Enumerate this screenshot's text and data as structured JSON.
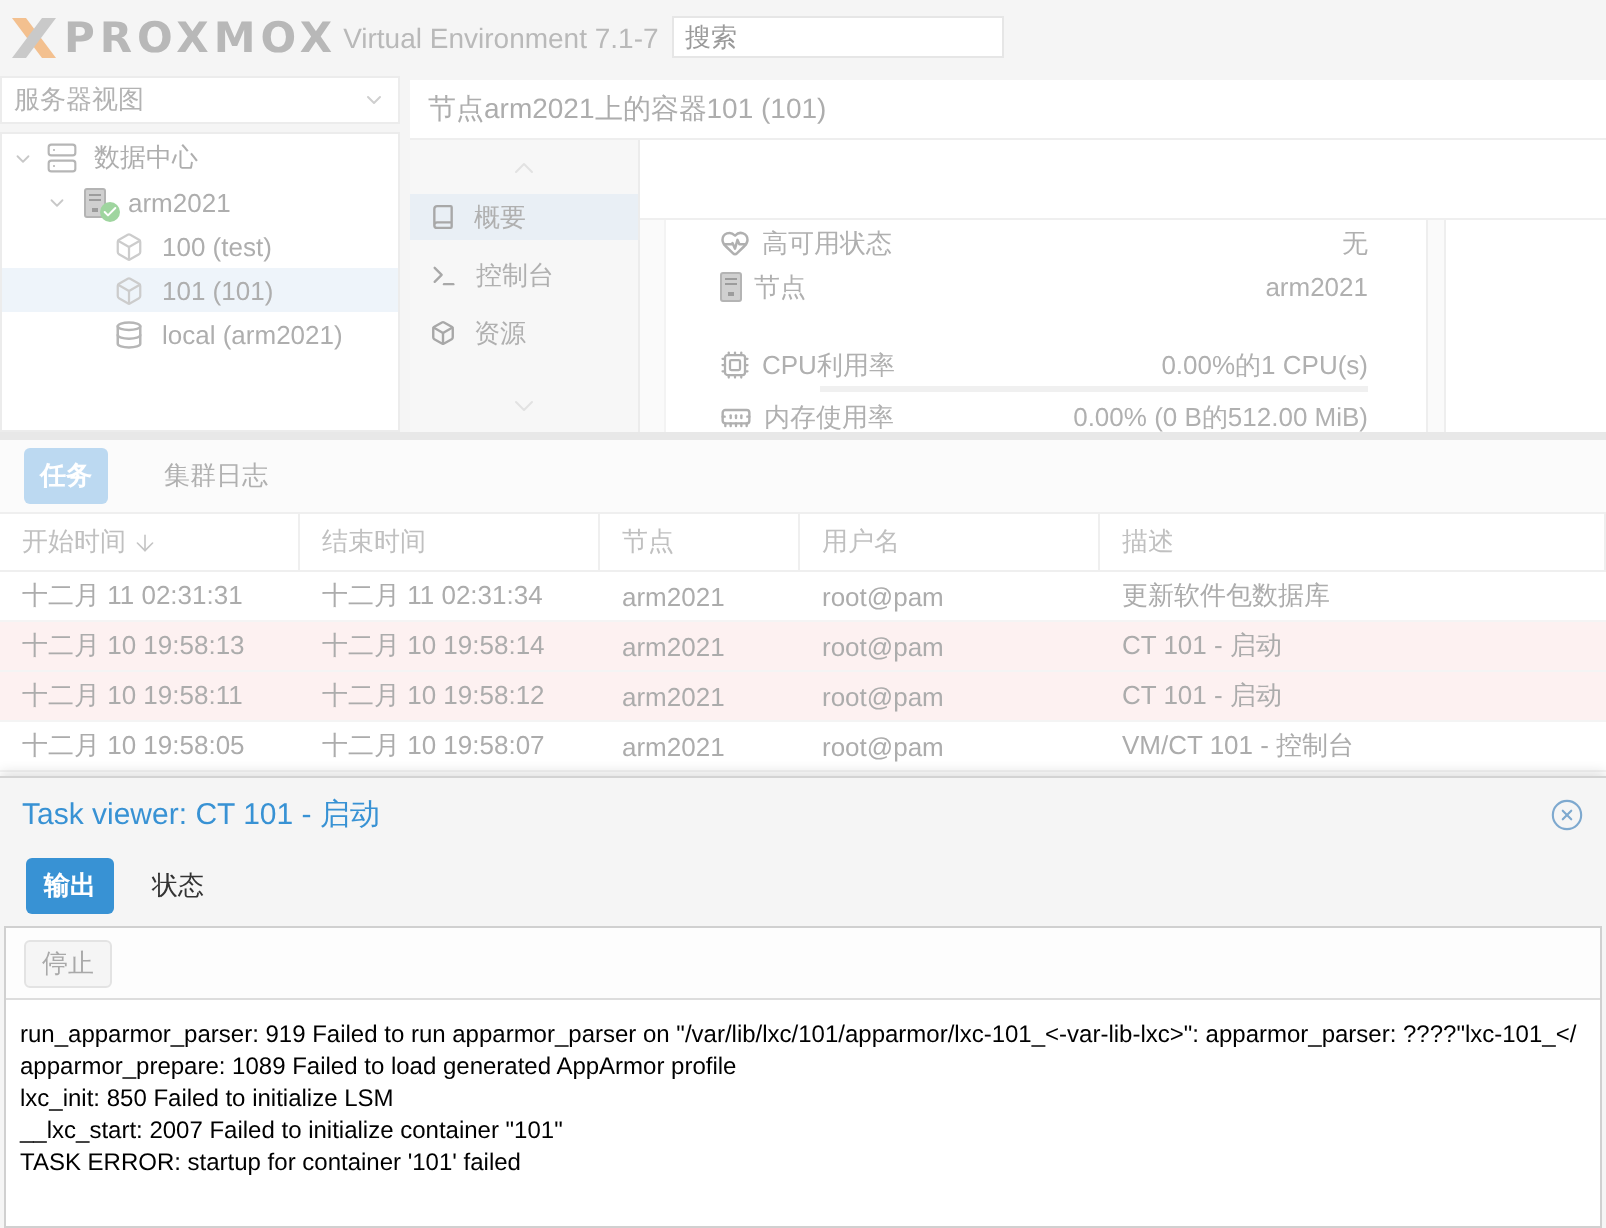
{
  "header": {
    "logo": "PROXMOX",
    "version": "Virtual Environment 7.1-7",
    "search": {
      "placeholder": "搜索"
    }
  },
  "sidebar": {
    "view_select": {
      "value": "服务器视图"
    },
    "tree": [
      {
        "kind": "datacenter",
        "label": "数据中心",
        "expanded": true,
        "selected": false,
        "children": [
          {
            "kind": "node",
            "label": "arm2021",
            "expanded": true,
            "selected": false,
            "online": true,
            "children": [
              {
                "kind": "container",
                "label": "100 (test)",
                "selected": false
              },
              {
                "kind": "container",
                "label": "101 (101)",
                "selected": true
              },
              {
                "kind": "storage",
                "label": "local (arm2021)",
                "selected": false
              }
            ]
          }
        ]
      }
    ]
  },
  "content": {
    "title": "节点arm2021上的容器101 (101)",
    "nav": [
      {
        "kind": "summary",
        "label": "概要",
        "selected": true
      },
      {
        "kind": "console",
        "label": "控制台",
        "selected": false
      },
      {
        "kind": "resources",
        "label": "资源",
        "selected": false
      }
    ],
    "summary_groups": [
      {
        "rows": [
          {
            "kind": "ha",
            "label": "高可用状态",
            "value": "无"
          },
          {
            "kind": "node",
            "label": "节点",
            "value": "arm2021"
          }
        ]
      },
      {
        "rows": [
          {
            "kind": "cpu",
            "label": "CPU利用率",
            "value": "0.00%的1 CPU(s)"
          },
          {
            "kind": "memory",
            "label": "内存使用率",
            "value": "0.00% (0 B的512.00 MiB)"
          }
        ]
      }
    ]
  },
  "log_panel": {
    "tabs": [
      {
        "label": "任务",
        "selected": true
      },
      {
        "label": "集群日志",
        "selected": false
      }
    ],
    "columns": [
      {
        "label": "开始时间",
        "sorted": true
      },
      {
        "label": "结束时间",
        "sorted": false
      },
      {
        "label": "节点",
        "sorted": false
      },
      {
        "label": "用户名",
        "sorted": false
      },
      {
        "label": "描述",
        "sorted": false
      }
    ],
    "rows": [
      {
        "error": false,
        "cells": [
          "十二月 11 02:31:31",
          "十二月 11 02:31:34",
          "arm2021",
          "root@pam",
          "更新软件包数据库"
        ]
      },
      {
        "error": true,
        "cells": [
          "十二月 10 19:58:13",
          "十二月 10 19:58:14",
          "arm2021",
          "root@pam",
          "CT 101 - 启动"
        ]
      },
      {
        "error": true,
        "cells": [
          "十二月 10 19:58:11",
          "十二月 10 19:58:12",
          "arm2021",
          "root@pam",
          "CT 101 - 启动"
        ]
      },
      {
        "error": false,
        "cells": [
          "十二月 10 19:58:05",
          "十二月 10 19:58:07",
          "arm2021",
          "root@pam",
          "VM/CT 101 - 控制台"
        ]
      }
    ]
  },
  "task_viewer": {
    "title": "Task viewer: CT 101 - 启动",
    "tabs": [
      {
        "label": "输出",
        "selected": true
      },
      {
        "label": "状态",
        "selected": false
      }
    ],
    "stop_button": {
      "label": "停止",
      "disabled": true
    },
    "log": [
      "run_apparmor_parser: 919 Failed to run apparmor_parser on \"/var/lib/lxc/101/apparmor/lxc-101_<-var-lib-lxc>\": apparmor_parser: ????\"lxc-101_</",
      "apparmor_prepare: 1089 Failed to load generated AppArmor profile",
      "lxc_init: 850 Failed to initialize LSM",
      "__lxc_start: 2007 Failed to initialize container \"101\"",
      "TASK ERROR: startup for container '101' failed"
    ]
  }
}
